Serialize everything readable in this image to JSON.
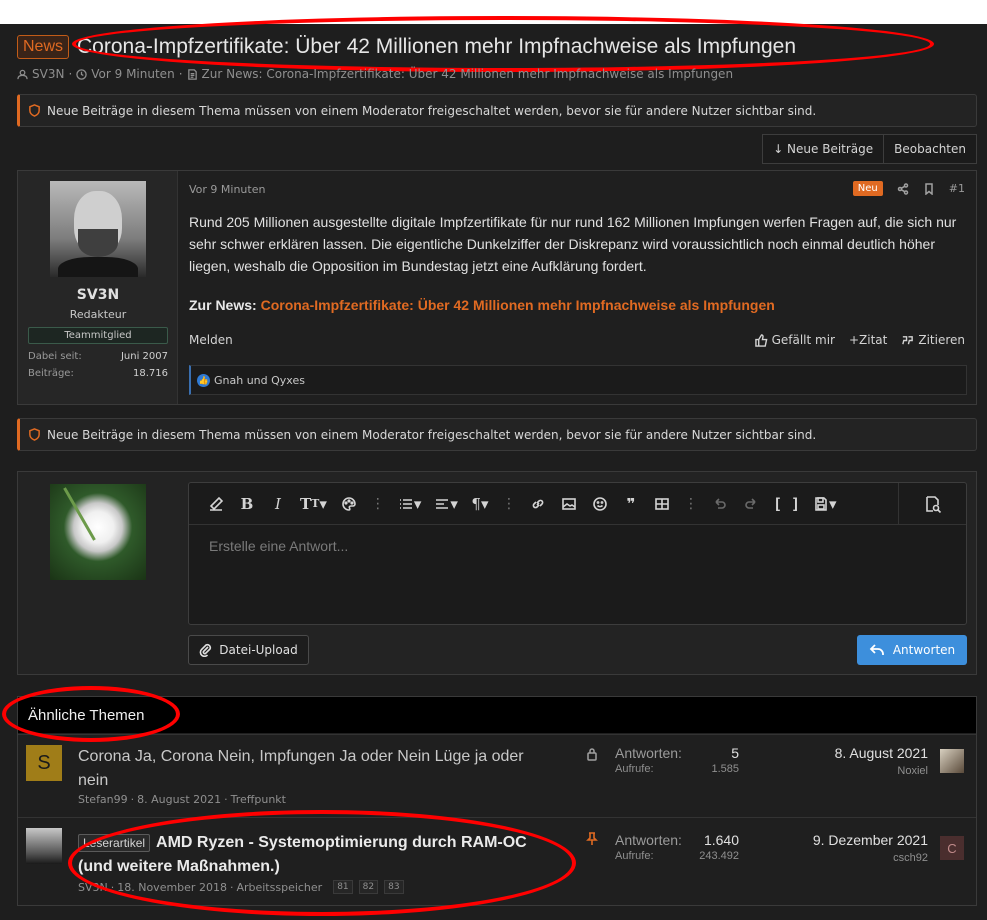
{
  "thread": {
    "prefix": "News",
    "title": "Corona-Impfzertifikate: Über 42 Millionen mehr Impfnachweise als Impfungen",
    "author": "SV3N",
    "time": "Vor 9 Minuten",
    "news_link": "Zur News: Corona-Impfzertifikate: Über 42 Millionen mehr Impfnachweise als Impfungen"
  },
  "notice": "Neue Beiträge in diesem Thema müssen von einem Moderator freigeschaltet werden, bevor sie für andere Nutzer sichtbar sind.",
  "thread_buttons": {
    "new_posts": "↓ Neue Beiträge",
    "watch": "Beobachten"
  },
  "post": {
    "user": {
      "name": "SV3N",
      "role": "Redakteur",
      "badge": "Teammitglied",
      "joined_label": "Dabei seit:",
      "joined": "Juni 2007",
      "posts_label": "Beiträge:",
      "posts": "18.716"
    },
    "date": "Vor 9 Minuten",
    "new_badge": "Neu",
    "number": "#1",
    "body": "Rund 205 Millionen ausgestellte digitale Impfzertifikate für nur rund 162 Millionen Impfungen werfen Fragen auf, die sich nur sehr schwer erklären lassen. Die eigentliche Dunkelziffer der Diskrepanz wird voraussichtlich noch einmal deutlich höher liegen, weshalb die Opposition im Bundestag jetzt eine Aufklärung fordert.",
    "link_label": "Zur News:",
    "link_text": "Corona-Impfzertifikate: Über 42 Millionen mehr Impfnachweise als Impfungen",
    "report": "Melden",
    "like": "Gefällt mir",
    "plus_quote": "+Zitat",
    "quote": "Zitieren",
    "reactions": "Gnah und Qyxes"
  },
  "reply": {
    "placeholder": "Erstelle eine Antwort...",
    "upload": "Datei-Upload",
    "submit": "Antworten"
  },
  "similar": {
    "heading": "Ähnliche Themen",
    "rows": [
      {
        "avatar_letter": "S",
        "avatar_color": "#a07d18",
        "prefix": "",
        "title": "Corona Ja, Corona Nein, Impfungen Ja oder Nein Lüge ja oder nein",
        "author": "Stefan99",
        "date": "8. August 2021",
        "forum": "Treffpunkt",
        "replies_label": "Antworten:",
        "replies": "5",
        "views_label": "Aufrufe:",
        "views": "1.585",
        "last_date": "8. August 2021",
        "last_user": "Noxiel"
      },
      {
        "prefix": "Leserartikel",
        "title": "AMD Ryzen - Systemoptimierung durch RAM-OC (und weitere Maßnahmen.)",
        "author": "SV3N",
        "date": "18. November 2018",
        "forum": "Arbeitsspeicher",
        "pages": [
          "81",
          "82",
          "83"
        ],
        "replies_label": "Antworten:",
        "replies": "1.640",
        "views_label": "Aufrufe:",
        "views": "243.492",
        "last_date": "9. Dezember 2021",
        "last_user": "csch92",
        "last_letter": "C"
      }
    ]
  },
  "colors": {
    "accent": "#e06a22",
    "link_blue": "#3d8fdc",
    "annotation": "#ff0000"
  }
}
